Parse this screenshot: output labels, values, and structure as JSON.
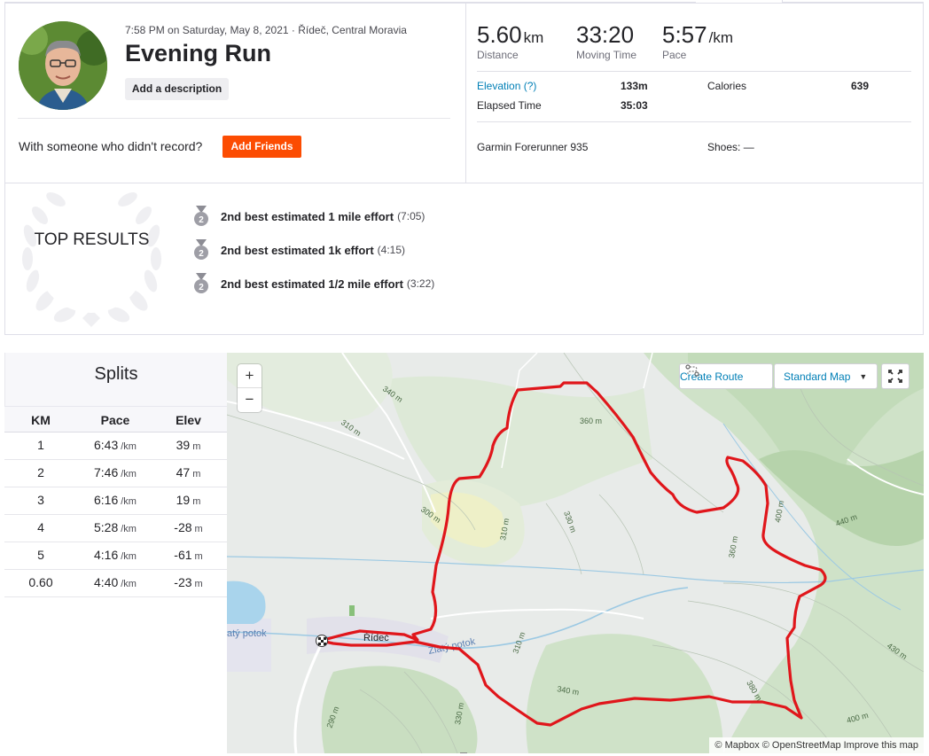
{
  "activity": {
    "datetime": "7:58 PM on Saturday, May 8, 2021",
    "location": "Řídeč, Central Moravia",
    "title": "Evening Run",
    "add_description": "Add a description",
    "friends_prompt": "With someone who didn't record?",
    "add_friends": "Add Friends"
  },
  "stats": {
    "distance": {
      "value": "5.60",
      "unit": "km",
      "label": "Distance"
    },
    "moving_time": {
      "value": "33:20",
      "label": "Moving Time"
    },
    "pace": {
      "value": "5:57",
      "unit": "/km",
      "label": "Pace"
    },
    "elevation_label": "Elevation (?)",
    "elevation_value": "133m",
    "calories_label": "Calories",
    "calories_value": "639",
    "elapsed_label": "Elapsed Time",
    "elapsed_value": "35:03",
    "device": "Garmin Forerunner 935",
    "shoes": "Shoes: —"
  },
  "top_results": {
    "title": "TOP RESULTS",
    "items": [
      {
        "rank": "2",
        "text": "2nd best estimated 1 mile effort",
        "time": "(7:05)"
      },
      {
        "rank": "2",
        "text": "2nd best estimated 1k effort",
        "time": "(4:15)"
      },
      {
        "rank": "2",
        "text": "2nd best estimated 1/2 mile effort",
        "time": "(3:22)"
      }
    ]
  },
  "splits": {
    "title": "Splits",
    "headers": [
      "KM",
      "Pace",
      "Elev"
    ],
    "pace_unit": "/km",
    "elev_unit": "m",
    "rows": [
      {
        "km": "1",
        "pace": "6:43",
        "elev": "39"
      },
      {
        "km": "2",
        "pace": "7:46",
        "elev": "47"
      },
      {
        "km": "3",
        "pace": "6:16",
        "elev": "19"
      },
      {
        "km": "4",
        "pace": "5:28",
        "elev": "-28"
      },
      {
        "km": "5",
        "pace": "4:16",
        "elev": "-61"
      },
      {
        "km": "0.60",
        "pace": "4:40",
        "elev": "-23"
      }
    ]
  },
  "map": {
    "zoom_in": "+",
    "zoom_out": "−",
    "create_route": "Create Route",
    "map_type": "Standard Map",
    "attribution": "© Mapbox © OpenStreetMap Improve this map",
    "place_label": "Řídeč",
    "stream_label_1": "Zlatý potok",
    "stream_label_2": "atý potok",
    "contours": [
      "340 m",
      "310 m",
      "360 m",
      "300 m",
      "310 m",
      "330 m",
      "360 m",
      "400 m",
      "440 m",
      "310 m",
      "340 m",
      "380 m",
      "430 m",
      "400 m",
      "330 m",
      "290 m"
    ],
    "route_color": "#e0161b"
  }
}
